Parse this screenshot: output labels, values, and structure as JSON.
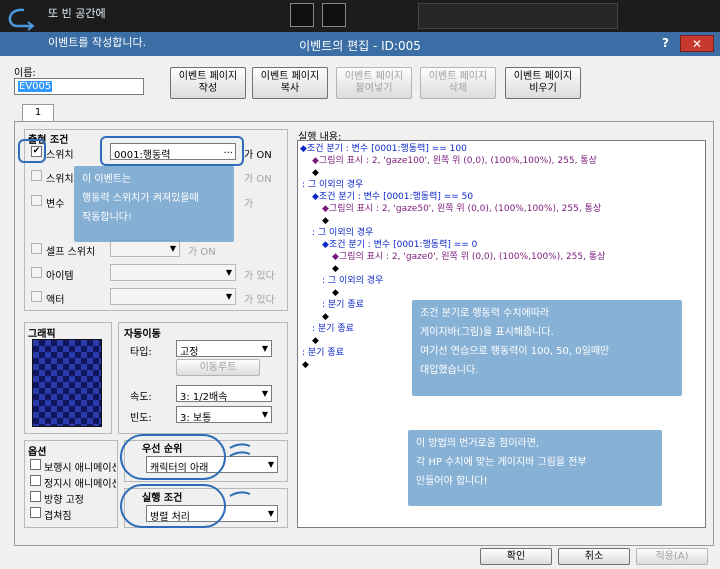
{
  "overlay_note_top": {
    "line1": "또 빈 공간에",
    "line2": "이벤트를 작성합니다."
  },
  "window": {
    "title": "이벤트의 편집 - ID:005",
    "help": "?",
    "close": "✕"
  },
  "name_label": "이름:",
  "name_value": "EV005",
  "toolbar": {
    "new_page": "이벤트 페이지\n작성",
    "copy_page": "이벤트 페이지\n복사",
    "paste_page": "이벤트 페이지\n붙여넣기",
    "delete_page": "이벤트 페이지\n삭제",
    "clear_page": "이벤트 페이지\n비우기"
  },
  "page_tab": "1",
  "conditions": {
    "title": "출현 조건",
    "switch1": {
      "label": "스위치",
      "value": "0001:행동력",
      "suffix": "가 ON",
      "dots": "..."
    },
    "switch2": {
      "label": "스위치",
      "suffix": "가 ON"
    },
    "variable": {
      "label": "변수",
      "suffix": "가"
    },
    "self_switch": {
      "label": "셀프 스위치",
      "suffix": "가 ON"
    },
    "item": {
      "label": "아이템",
      "suffix": "가 있다"
    },
    "actor": {
      "label": "액터",
      "suffix": "가 있다"
    }
  },
  "graphic_title": "그래픽",
  "autonomous": {
    "title": "자동이동",
    "type_label": "타입:",
    "type_value": "고정",
    "route_button": "이동루트",
    "speed_label": "속도:",
    "speed_value": "3: 1/2배속",
    "freq_label": "빈도:",
    "freq_value": "3: 보통"
  },
  "options": {
    "title": "옵션",
    "items": [
      "보행시 애니메이션",
      "정지시 애니메이션",
      "방향 고정",
      "겹쳐짐"
    ]
  },
  "priority": {
    "title": "우선 순위",
    "value": "캐릭터의 아래"
  },
  "trigger": {
    "title": "실행 조건",
    "value": "병렬 처리"
  },
  "contents": {
    "title": "실행 내용:",
    "lines": [
      "◆조건 분기 : 변수 [0001:행동력] == 100",
      "◆그림의 표시 : 2, 'gaze100', 왼쪽 위 (0,0), (100%,100%), 255, 통상",
      "◆",
      ": 그 이외의 경우",
      "◆조건 분기 : 변수 [0001:행동력] == 50",
      "◆그림의 표시 : 2, 'gaze50', 왼쪽 위 (0,0), (100%,100%), 255, 통상",
      "◆",
      ": 그 이외의 경우",
      "◆조건 분기 : 변수 [0001:행동력] == 0",
      "◆그림의 표시 : 2, 'gaze0', 왼쪽 위 (0,0), (100%,100%), 255, 통상",
      "◆",
      ": 그 이외의 경우",
      "◆",
      ": 분기 종료",
      "◆",
      ": 분기 종료",
      "◆",
      ": 분기 종료",
      "◆"
    ]
  },
  "notes": {
    "n1": [
      "이 이벤트는",
      "행동력 스위치가 켜져있을때",
      "작동합니다!"
    ],
    "n2": [
      "조건 분기로 행동력 수치에따라",
      "게이지바(그림)을 표시해줍니다.",
      "여기선 연습으로 행동력이 100, 50, 0일때만",
      "대입했습니다."
    ],
    "n3": [
      "이 방법의 번거로움 점이라면,",
      "각 HP 수치에 맞는 게이지바 그림을 전부",
      "만들어야 합니다!"
    ]
  },
  "footer": {
    "ok": "확인",
    "cancel": "취소",
    "apply": "적용(A)"
  },
  "colors": {
    "title_bar": "#3a6ea5",
    "tree_blue": "#0a26c8",
    "tree_purple": "#7a1b7a",
    "note_bg": "#6ea0cd",
    "highlight": "#2f6cb8"
  }
}
